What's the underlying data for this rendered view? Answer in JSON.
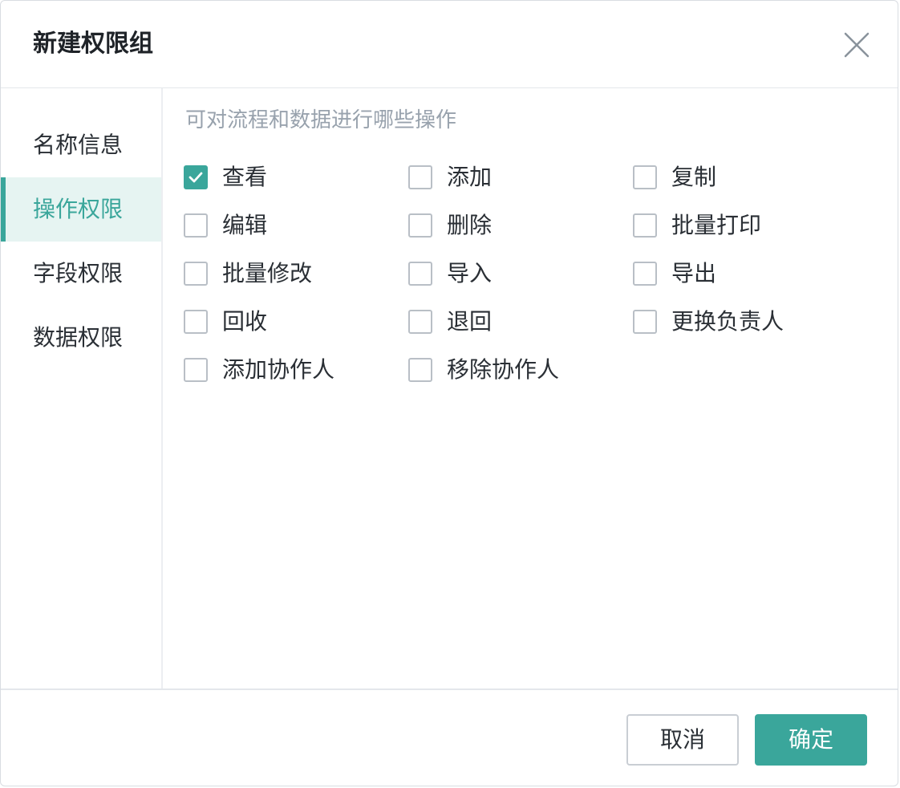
{
  "dialog": {
    "title": "新建权限组",
    "close_icon": "close-icon"
  },
  "sidebar": {
    "items": [
      {
        "label": "名称信息",
        "active": false
      },
      {
        "label": "操作权限",
        "active": true
      },
      {
        "label": "字段权限",
        "active": false
      },
      {
        "label": "数据权限",
        "active": false
      }
    ]
  },
  "content": {
    "hint": "可对流程和数据进行哪些操作",
    "permissions": [
      {
        "label": "查看",
        "checked": true
      },
      {
        "label": "添加",
        "checked": false
      },
      {
        "label": "复制",
        "checked": false
      },
      {
        "label": "编辑",
        "checked": false
      },
      {
        "label": "删除",
        "checked": false
      },
      {
        "label": "批量打印",
        "checked": false
      },
      {
        "label": "批量修改",
        "checked": false
      },
      {
        "label": "导入",
        "checked": false
      },
      {
        "label": "导出",
        "checked": false
      },
      {
        "label": "回收",
        "checked": false
      },
      {
        "label": "退回",
        "checked": false
      },
      {
        "label": "更换负责人",
        "checked": false
      },
      {
        "label": "添加协作人",
        "checked": false
      },
      {
        "label": "移除协作人",
        "checked": false
      }
    ]
  },
  "footer": {
    "cancel_label": "取消",
    "ok_label": "确定"
  },
  "colors": {
    "accent": "#3aa69b",
    "accent_bg": "#e6f4f2",
    "hint_text": "#98a2ad"
  }
}
